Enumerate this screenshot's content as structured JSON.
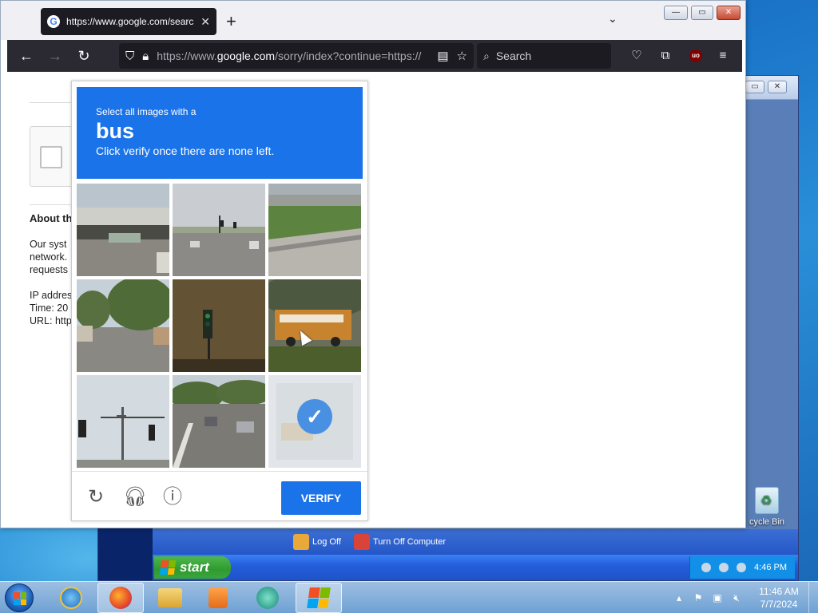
{
  "browser": {
    "tab_title": "https://www.google.com/search",
    "url_prefix": "https://www.",
    "url_domain": "google.com",
    "url_suffix": "/sorry/index?continue=https://",
    "search_placeholder": "Search",
    "ublock_label": "uo"
  },
  "page": {
    "about_heading": "About th",
    "para_lines": [
      "Our syst",
      "network.",
      "requests"
    ],
    "meta_lines": [
      "IP addres",
      "Time: 20",
      "URL: http"
    ]
  },
  "captcha": {
    "instruction": "Select all images with a",
    "target": "bus",
    "subtext": "Click verify once there are none left.",
    "verify_label": "VERIFY",
    "tiles": [
      {
        "name": "tile-1",
        "desc": "overpass",
        "selected": false
      },
      {
        "name": "tile-2",
        "desc": "road-traffic-lights",
        "selected": false
      },
      {
        "name": "tile-3",
        "desc": "grass-wall",
        "selected": false
      },
      {
        "name": "tile-4",
        "desc": "tree-street",
        "selected": false
      },
      {
        "name": "tile-5",
        "desc": "traffic-light-building",
        "selected": false
      },
      {
        "name": "tile-6",
        "desc": "bus-yard",
        "selected": false
      },
      {
        "name": "tile-7",
        "desc": "signal-pole",
        "selected": false
      },
      {
        "name": "tile-8",
        "desc": "road-cars",
        "selected": false
      },
      {
        "name": "tile-9",
        "desc": "fading-selected",
        "selected": true
      }
    ]
  },
  "vm": {
    "start_label": "start",
    "logoff_label": "Log Off",
    "turnoff_label": "Turn Off Computer",
    "clock": "4:46 PM"
  },
  "desktop": {
    "recycle_label": "cycle Bin"
  },
  "taskbar": {
    "time": "11:46 AM",
    "date": "7/7/2024"
  }
}
